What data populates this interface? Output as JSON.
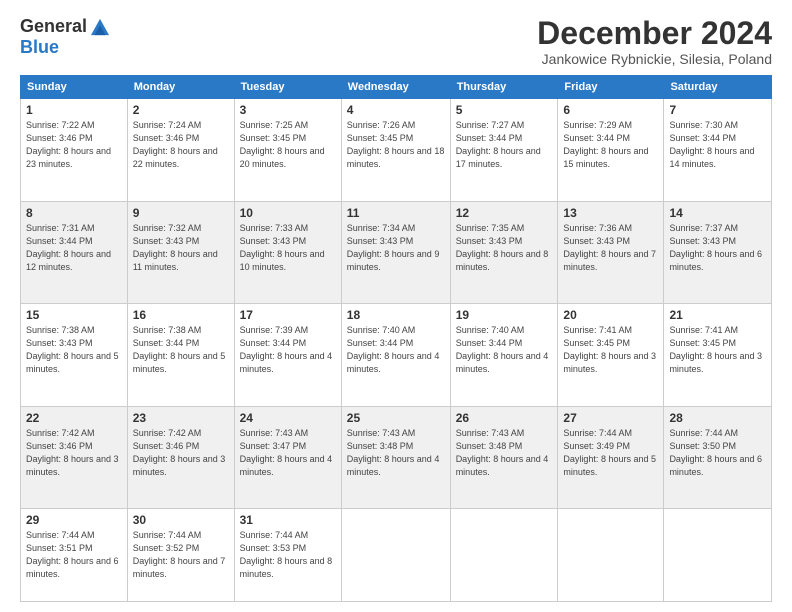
{
  "header": {
    "logo_general": "General",
    "logo_blue": "Blue",
    "title": "December 2024",
    "location": "Jankowice Rybnickie, Silesia, Poland"
  },
  "days_of_week": [
    "Sunday",
    "Monday",
    "Tuesday",
    "Wednesday",
    "Thursday",
    "Friday",
    "Saturday"
  ],
  "weeks": [
    [
      {
        "day": "1",
        "sunrise": "7:22 AM",
        "sunset": "3:46 PM",
        "daylight": "8 hours and 23 minutes."
      },
      {
        "day": "2",
        "sunrise": "7:24 AM",
        "sunset": "3:46 PM",
        "daylight": "8 hours and 22 minutes."
      },
      {
        "day": "3",
        "sunrise": "7:25 AM",
        "sunset": "3:45 PM",
        "daylight": "8 hours and 20 minutes."
      },
      {
        "day": "4",
        "sunrise": "7:26 AM",
        "sunset": "3:45 PM",
        "daylight": "8 hours and 18 minutes."
      },
      {
        "day": "5",
        "sunrise": "7:27 AM",
        "sunset": "3:44 PM",
        "daylight": "8 hours and 17 minutes."
      },
      {
        "day": "6",
        "sunrise": "7:29 AM",
        "sunset": "3:44 PM",
        "daylight": "8 hours and 15 minutes."
      },
      {
        "day": "7",
        "sunrise": "7:30 AM",
        "sunset": "3:44 PM",
        "daylight": "8 hours and 14 minutes."
      }
    ],
    [
      {
        "day": "8",
        "sunrise": "7:31 AM",
        "sunset": "3:44 PM",
        "daylight": "8 hours and 12 minutes."
      },
      {
        "day": "9",
        "sunrise": "7:32 AM",
        "sunset": "3:43 PM",
        "daylight": "8 hours and 11 minutes."
      },
      {
        "day": "10",
        "sunrise": "7:33 AM",
        "sunset": "3:43 PM",
        "daylight": "8 hours and 10 minutes."
      },
      {
        "day": "11",
        "sunrise": "7:34 AM",
        "sunset": "3:43 PM",
        "daylight": "8 hours and 9 minutes."
      },
      {
        "day": "12",
        "sunrise": "7:35 AM",
        "sunset": "3:43 PM",
        "daylight": "8 hours and 8 minutes."
      },
      {
        "day": "13",
        "sunrise": "7:36 AM",
        "sunset": "3:43 PM",
        "daylight": "8 hours and 7 minutes."
      },
      {
        "day": "14",
        "sunrise": "7:37 AM",
        "sunset": "3:43 PM",
        "daylight": "8 hours and 6 minutes."
      }
    ],
    [
      {
        "day": "15",
        "sunrise": "7:38 AM",
        "sunset": "3:43 PM",
        "daylight": "8 hours and 5 minutes."
      },
      {
        "day": "16",
        "sunrise": "7:38 AM",
        "sunset": "3:44 PM",
        "daylight": "8 hours and 5 minutes."
      },
      {
        "day": "17",
        "sunrise": "7:39 AM",
        "sunset": "3:44 PM",
        "daylight": "8 hours and 4 minutes."
      },
      {
        "day": "18",
        "sunrise": "7:40 AM",
        "sunset": "3:44 PM",
        "daylight": "8 hours and 4 minutes."
      },
      {
        "day": "19",
        "sunrise": "7:40 AM",
        "sunset": "3:44 PM",
        "daylight": "8 hours and 4 minutes."
      },
      {
        "day": "20",
        "sunrise": "7:41 AM",
        "sunset": "3:45 PM",
        "daylight": "8 hours and 3 minutes."
      },
      {
        "day": "21",
        "sunrise": "7:41 AM",
        "sunset": "3:45 PM",
        "daylight": "8 hours and 3 minutes."
      }
    ],
    [
      {
        "day": "22",
        "sunrise": "7:42 AM",
        "sunset": "3:46 PM",
        "daylight": "8 hours and 3 minutes."
      },
      {
        "day": "23",
        "sunrise": "7:42 AM",
        "sunset": "3:46 PM",
        "daylight": "8 hours and 3 minutes."
      },
      {
        "day": "24",
        "sunrise": "7:43 AM",
        "sunset": "3:47 PM",
        "daylight": "8 hours and 4 minutes."
      },
      {
        "day": "25",
        "sunrise": "7:43 AM",
        "sunset": "3:48 PM",
        "daylight": "8 hours and 4 minutes."
      },
      {
        "day": "26",
        "sunrise": "7:43 AM",
        "sunset": "3:48 PM",
        "daylight": "8 hours and 4 minutes."
      },
      {
        "day": "27",
        "sunrise": "7:44 AM",
        "sunset": "3:49 PM",
        "daylight": "8 hours and 5 minutes."
      },
      {
        "day": "28",
        "sunrise": "7:44 AM",
        "sunset": "3:50 PM",
        "daylight": "8 hours and 6 minutes."
      }
    ],
    [
      {
        "day": "29",
        "sunrise": "7:44 AM",
        "sunset": "3:51 PM",
        "daylight": "8 hours and 6 minutes."
      },
      {
        "day": "30",
        "sunrise": "7:44 AM",
        "sunset": "3:52 PM",
        "daylight": "8 hours and 7 minutes."
      },
      {
        "day": "31",
        "sunrise": "7:44 AM",
        "sunset": "3:53 PM",
        "daylight": "8 hours and 8 minutes."
      },
      null,
      null,
      null,
      null
    ]
  ]
}
